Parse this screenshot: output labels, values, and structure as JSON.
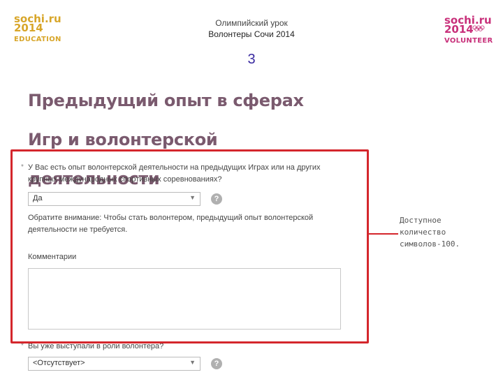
{
  "header": {
    "logo_left": {
      "word1": "sochi.ru",
      "word2": "2014",
      "sub": "EDUCATION"
    },
    "logo_right": {
      "word1": "sochi.ru",
      "word2": "2014",
      "sub": "VOLUNTEER"
    },
    "title_line1": "Олимпийский урок",
    "title_line2": "Волонтеры Сочи 2014",
    "slide_number": "3"
  },
  "main_heading": "Предыдущий опыт в сферах Игр и волонтерской деятельности",
  "form": {
    "question1_required": "*",
    "question1": "У Вас есть опыт волонтерской деятельности на предыдущих Играх или на других крупных международных спортивных соревнованиях?",
    "select1_value": "Да",
    "help_glyph": "?",
    "note": "Обратите внимание: Чтобы стать волонтером, предыдущий опыт волонтерской деятельности не требуется.",
    "comment_label": "Комментарии",
    "comment_value": "",
    "question2_required": "*",
    "question2": "Вы уже выступали в роли волонтера?",
    "select2_value": "<Отсутствует>"
  },
  "callout": {
    "text": "Доступное количество символов-100."
  },
  "colors": {
    "highlight": "#d4262c",
    "heading": "#7a5a6e",
    "education_logo": "#d8a62a",
    "volunteer_logo": "#c8307a"
  },
  "icons": {
    "dropdown": "chevron-down-icon",
    "help": "question-mark-icon",
    "resize": "resize-grip-icon"
  }
}
